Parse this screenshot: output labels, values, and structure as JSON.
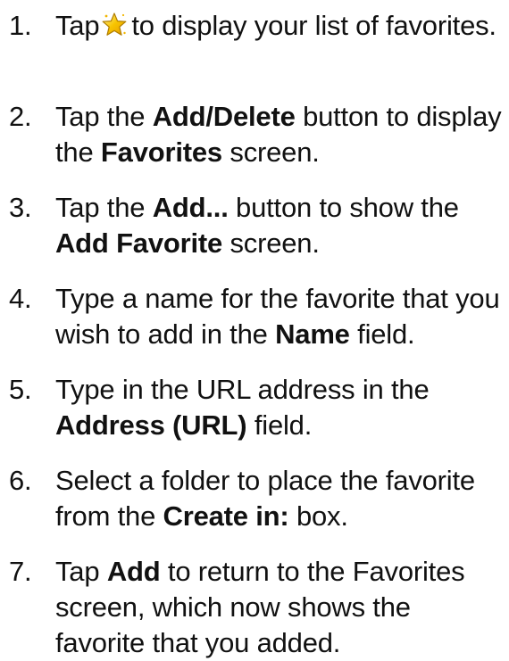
{
  "steps": [
    {
      "number": "1.",
      "before_icon": "Tap",
      "icon": "favorites-star-icon",
      "after_icon": "to display your list of favorites."
    },
    {
      "number": "2.",
      "t1": "Tap the",
      "b1": "Add/Delete",
      "t2": "button to display the",
      "b2": "Favorites",
      "t3": "screen."
    },
    {
      "number": "3.",
      "t1": "Tap the",
      "b1": "Add...",
      "t2": "button to show the",
      "b2": "Add Favorite",
      "t3": "screen."
    },
    {
      "number": "4.",
      "t1": "Type a name for the favorite that you wish to add in the",
      "b1": "Name",
      "t2": "field."
    },
    {
      "number": "5.",
      "t1": "Type in the URL address in the",
      "b1": "Address (URL)",
      "t2": "field."
    },
    {
      "number": "6.",
      "t1": "Select a folder to place the favorite from the",
      "b1": "Create in:",
      "t2": "box."
    },
    {
      "number": "7.",
      "t1": "Tap",
      "b1": "Add",
      "t2": "to return to the Favorites screen, which now shows the favorite that you added."
    }
  ],
  "colors": {
    "text": "#111111",
    "background": "#ffffff",
    "star_fill": "#f7c400",
    "star_outline": "#b07d00"
  }
}
